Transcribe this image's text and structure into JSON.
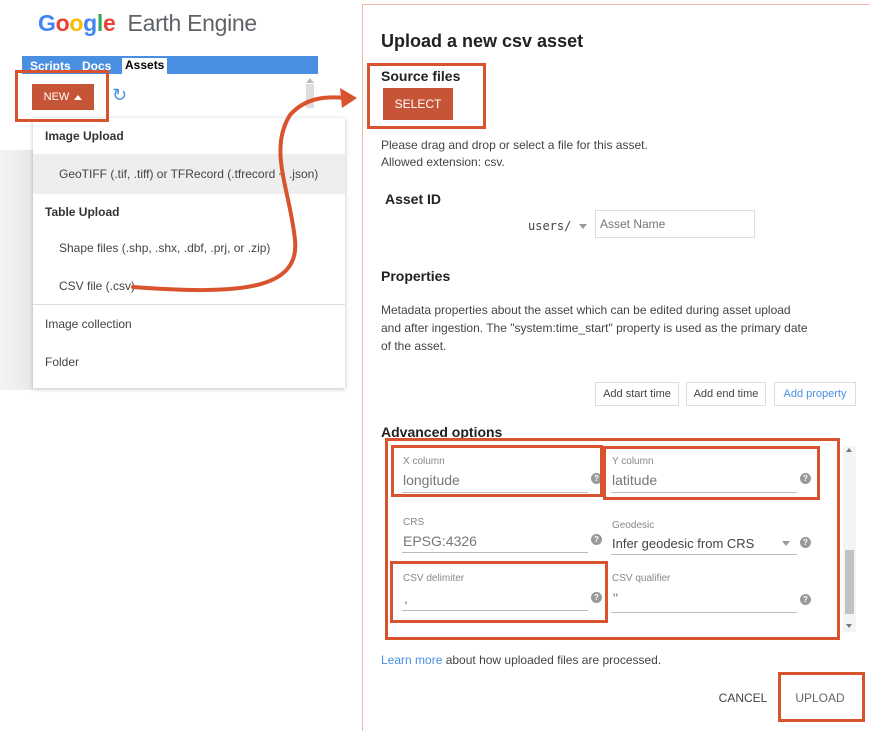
{
  "logo": {
    "google_letters": [
      "G",
      "o",
      "o",
      "g",
      "l",
      "e"
    ],
    "google_colors": [
      "#4285F4",
      "#EA4335",
      "#FBBC05",
      "#4285F4",
      "#34A853",
      "#EA4335"
    ],
    "product": "Earth Engine"
  },
  "tabs": {
    "scripts": "Scripts",
    "docs": "Docs",
    "assets": "Assets"
  },
  "new_button": "NEW",
  "menu": {
    "image_upload": "Image Upload",
    "geotiff": "GeoTIFF (.tif, .tiff) or TFRecord (.tfrecord + .json)",
    "table_upload": "Table Upload",
    "shape_files": "Shape files (.shp, .shx, .dbf, .prj, or .zip)",
    "csv_file": "CSV file (.csv)",
    "image_collection": "Image collection",
    "folder": "Folder"
  },
  "dialog": {
    "title": "Upload a new csv asset",
    "source_files": "Source files",
    "select_button": "SELECT",
    "drag_text_1": "Please drag and drop or select a file for this asset.",
    "drag_text_2": "Allowed extension: csv.",
    "asset_id": "Asset ID",
    "asset_prefix": "users/",
    "asset_placeholder": "Asset Name",
    "properties": "Properties",
    "properties_desc_1": "Metadata properties about the asset which can be edited during asset upload",
    "properties_desc_2": "and after ingestion. The \"system:time_start\" property is used as the primary date",
    "properties_desc_3": "of the asset.",
    "add_start_time": "Add start time",
    "add_end_time": "Add end time",
    "add_property": "Add property",
    "advanced_options": "Advanced options",
    "fields": {
      "x_column_label": "X column",
      "x_column_value": "longitude",
      "y_column_label": "Y column",
      "y_column_value": "latitude",
      "crs_label": "CRS",
      "crs_value": "EPSG:4326",
      "geodesic_label": "Geodesic",
      "geodesic_value": "Infer geodesic from CRS",
      "delimiter_label": "CSV delimiter",
      "delimiter_value": ",",
      "qualifier_label": "CSV qualifier",
      "qualifier_value": "\""
    },
    "learn_more_link": "Learn more",
    "learn_more_rest": " about how uploaded files are processed.",
    "cancel": "CANCEL",
    "upload": "UPLOAD"
  },
  "colors": {
    "accent": "#c65436",
    "annotation": "#d9532e",
    "link": "#4a90e2",
    "tabbar": "#4a90e2"
  }
}
